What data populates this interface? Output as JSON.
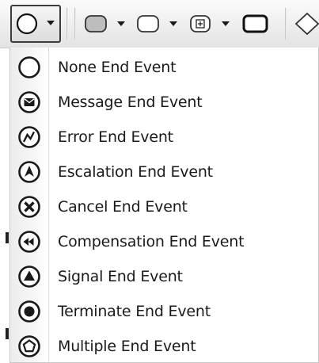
{
  "toolbar": {
    "tools": [
      {
        "icon": "end-event-circle-icon",
        "has_dropdown": true,
        "active": true
      },
      {
        "icon": "task-rounded-rect-icon",
        "has_dropdown": true
      },
      {
        "icon": "subprocess-rounded-rect-icon",
        "has_dropdown": true
      },
      {
        "icon": "collapsed-subprocess-icon",
        "has_dropdown": true
      },
      {
        "icon": "transaction-rect-icon",
        "has_dropdown": false
      },
      {
        "icon": "gateway-diamond-icon",
        "has_dropdown": false
      }
    ]
  },
  "menu": {
    "items": [
      {
        "label": "None End Event",
        "icon": "none-end-event-icon"
      },
      {
        "label": "Message End Event",
        "icon": "message-end-event-icon"
      },
      {
        "label": "Error End Event",
        "icon": "error-end-event-icon"
      },
      {
        "label": "Escalation End Event",
        "icon": "escalation-end-event-icon"
      },
      {
        "label": "Cancel End Event",
        "icon": "cancel-end-event-icon"
      },
      {
        "label": "Compensation End Event",
        "icon": "compensation-end-event-icon"
      },
      {
        "label": "Signal End Event",
        "icon": "signal-end-event-icon"
      },
      {
        "label": "Terminate End Event",
        "icon": "terminate-end-event-icon"
      },
      {
        "label": "Multiple End Event",
        "icon": "multiple-end-event-icon"
      }
    ]
  }
}
